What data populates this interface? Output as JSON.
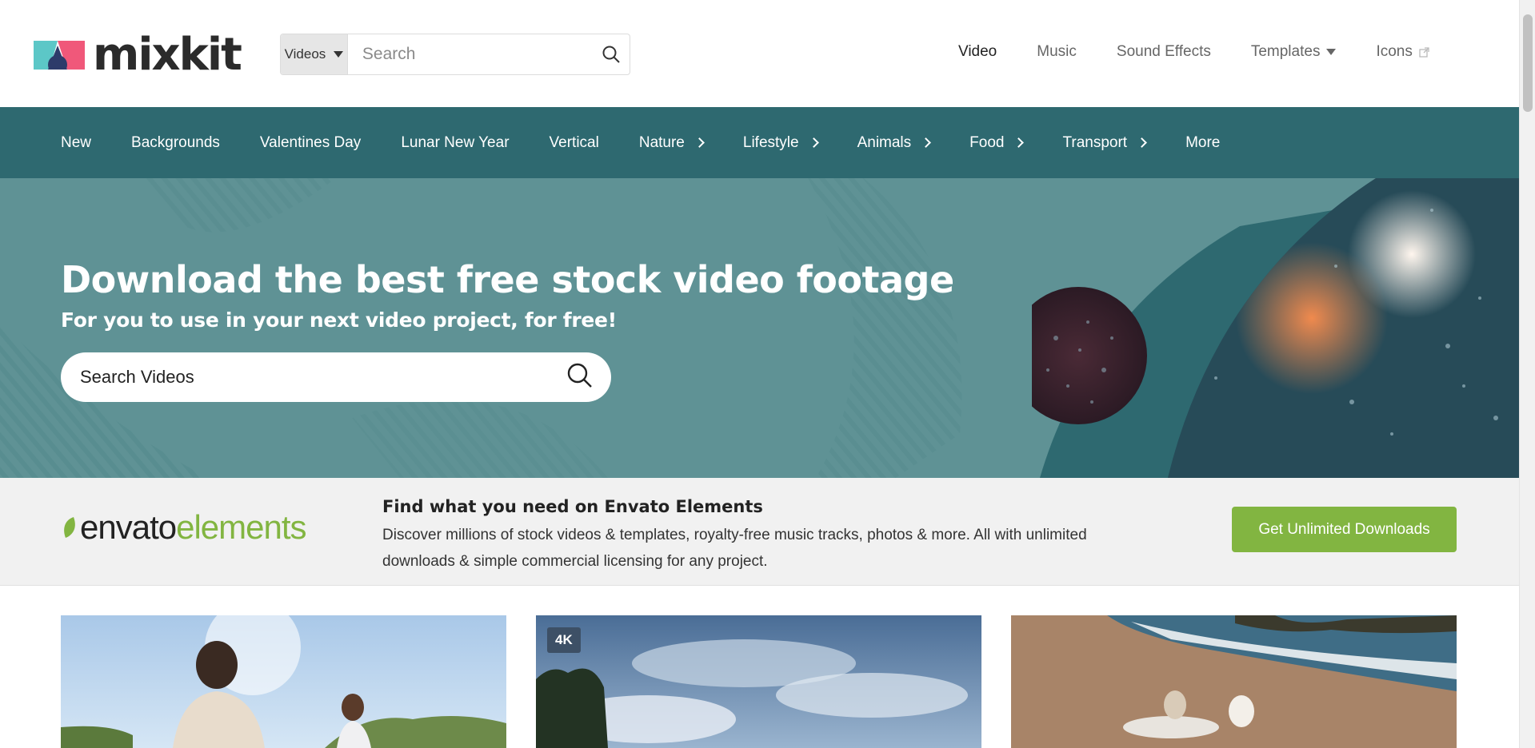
{
  "brand": {
    "name": "mixkit"
  },
  "search": {
    "type_label": "Videos",
    "placeholder": "Search"
  },
  "topnav": [
    {
      "label": "Video"
    },
    {
      "label": "Music"
    },
    {
      "label": "Sound Effects"
    },
    {
      "label": "Templates"
    },
    {
      "label": "Icons"
    }
  ],
  "categories": [
    {
      "label": "New"
    },
    {
      "label": "Backgrounds"
    },
    {
      "label": "Valentines Day"
    },
    {
      "label": "Lunar New Year"
    },
    {
      "label": "Vertical"
    },
    {
      "label": "Nature"
    },
    {
      "label": "Lifestyle"
    },
    {
      "label": "Animals"
    },
    {
      "label": "Food"
    },
    {
      "label": "Transport"
    },
    {
      "label": "More"
    }
  ],
  "hero": {
    "title": "Download the best free stock video footage",
    "subtitle": "For you to use in your next video project, for free!",
    "search_placeholder": "Search Videos"
  },
  "envato": {
    "logo_part1": "envato",
    "logo_part2": "elements",
    "title": "Find what you need on Envato Elements",
    "description": "Discover millions of stock videos & templates, royalty-free music tracks, photos & more. All with unlimited downloads & simple commercial licensing for any project.",
    "cta": "Get Unlimited Downloads"
  },
  "thumbnails": [
    {
      "badge": ""
    },
    {
      "badge": "4K"
    },
    {
      "badge": ""
    }
  ],
  "colors": {
    "teal_dark": "#2e6970",
    "teal_hero": "#5f9295",
    "envato_green": "#82b541",
    "badge": "#3d5066"
  }
}
